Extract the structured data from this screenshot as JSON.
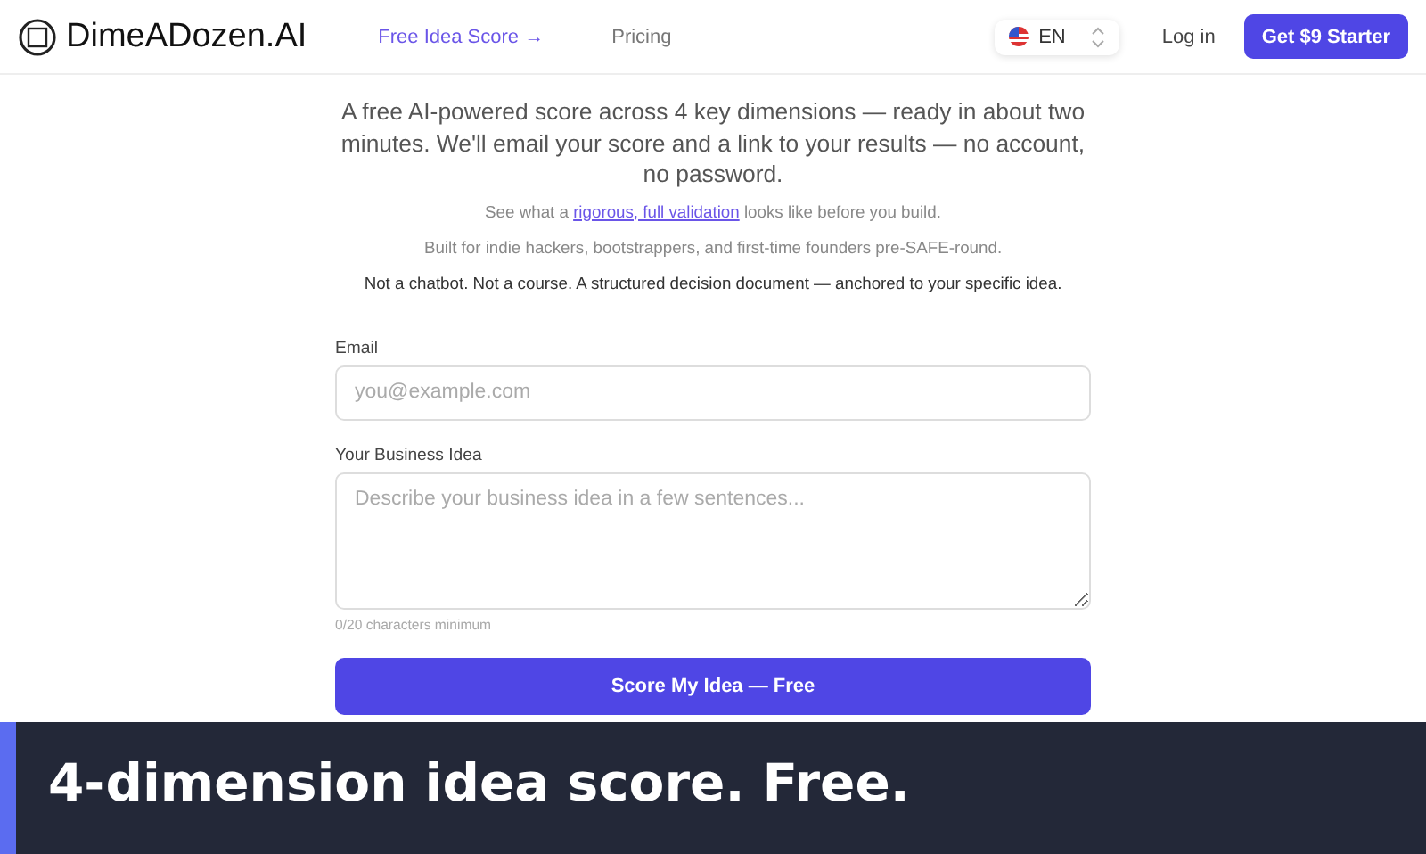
{
  "header": {
    "logo_text": "DimeADozen.AI",
    "nav": [
      {
        "label": "Free Idea Score →",
        "selected": true
      },
      {
        "label": "Pricing",
        "selected": false
      }
    ],
    "language": "EN",
    "login": "Log in",
    "cta": "Get $9 Starter"
  },
  "intro": {
    "lead": "A free AI-powered score across 4 key dimensions — ready in about two minutes. We'll email your score and a link to your results — no account, no password.",
    "see_before": "See what a ",
    "see_link": "rigorous, full validation",
    "see_after": " looks like before you build.",
    "audience": "Built for indie hackers, bootstrappers, and first-time founders pre-SAFE-round.",
    "tagline": "Not a chatbot. Not a course. A structured decision document — anchored to your specific idea."
  },
  "form": {
    "email_label": "Email",
    "email_placeholder": "you@example.com",
    "idea_label": "Your Business Idea",
    "idea_placeholder": "Describe your business idea in a few sentences...",
    "counter": "0/20 characters minimum",
    "submit": "Score My Idea — Free"
  },
  "banner": {
    "caption": "4-dimension idea score. Free."
  }
}
